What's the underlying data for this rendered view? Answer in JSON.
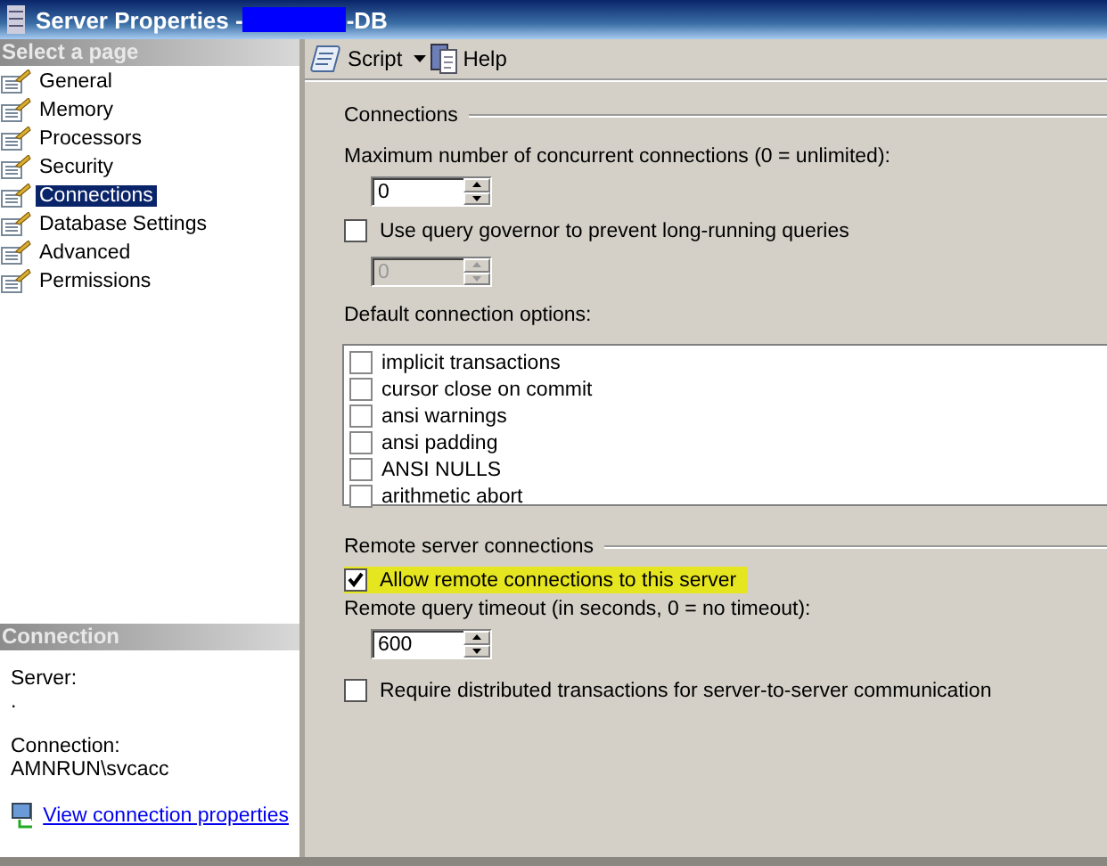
{
  "window": {
    "title_prefix": "Server Properties - ",
    "title_suffix": "-DB",
    "redacted": true
  },
  "sidebar": {
    "header": "Select a page",
    "items": [
      {
        "label": "General",
        "selected": false
      },
      {
        "label": "Memory",
        "selected": false
      },
      {
        "label": "Processors",
        "selected": false
      },
      {
        "label": "Security",
        "selected": false
      },
      {
        "label": "Connections",
        "selected": true
      },
      {
        "label": "Database Settings",
        "selected": false
      },
      {
        "label": "Advanced",
        "selected": false
      },
      {
        "label": "Permissions",
        "selected": false
      }
    ]
  },
  "connection_panel": {
    "header": "Connection",
    "server_label": "Server:",
    "server_value": ".",
    "connection_label": "Connection:",
    "connection_value": "AMNRUN\\svcacc",
    "link": "View connection properties"
  },
  "toolbar": {
    "script": "Script",
    "help": "Help"
  },
  "connections": {
    "heading": "Connections",
    "max_label": "Maximum number of concurrent connections (0 = unlimited):",
    "max_value": {
      "value": "0",
      "disabled": false
    },
    "governor": {
      "label": "Use query governor to prevent long-running queries",
      "checked": false,
      "highlighted": false
    },
    "governor_value": {
      "value": "0",
      "disabled": true
    },
    "options_label": "Default connection options:",
    "options": [
      {
        "label": "implicit transactions",
        "checked": false
      },
      {
        "label": "cursor close on commit",
        "checked": false
      },
      {
        "label": "ansi warnings",
        "checked": false
      },
      {
        "label": "ansi padding",
        "checked": false
      },
      {
        "label": "ANSI NULLS",
        "checked": false
      },
      {
        "label": "arithmetic abort",
        "checked": false
      }
    ]
  },
  "remote": {
    "heading": "Remote server connections",
    "allow": {
      "label": "Allow remote connections to this server",
      "checked": true,
      "highlighted": true
    },
    "timeout_label": "Remote query timeout (in seconds, 0 = no timeout):",
    "timeout_value": {
      "value": "600",
      "disabled": false
    },
    "distributed": {
      "label": "Require distributed transactions for server-to-server communication",
      "checked": false,
      "highlighted": false
    }
  }
}
